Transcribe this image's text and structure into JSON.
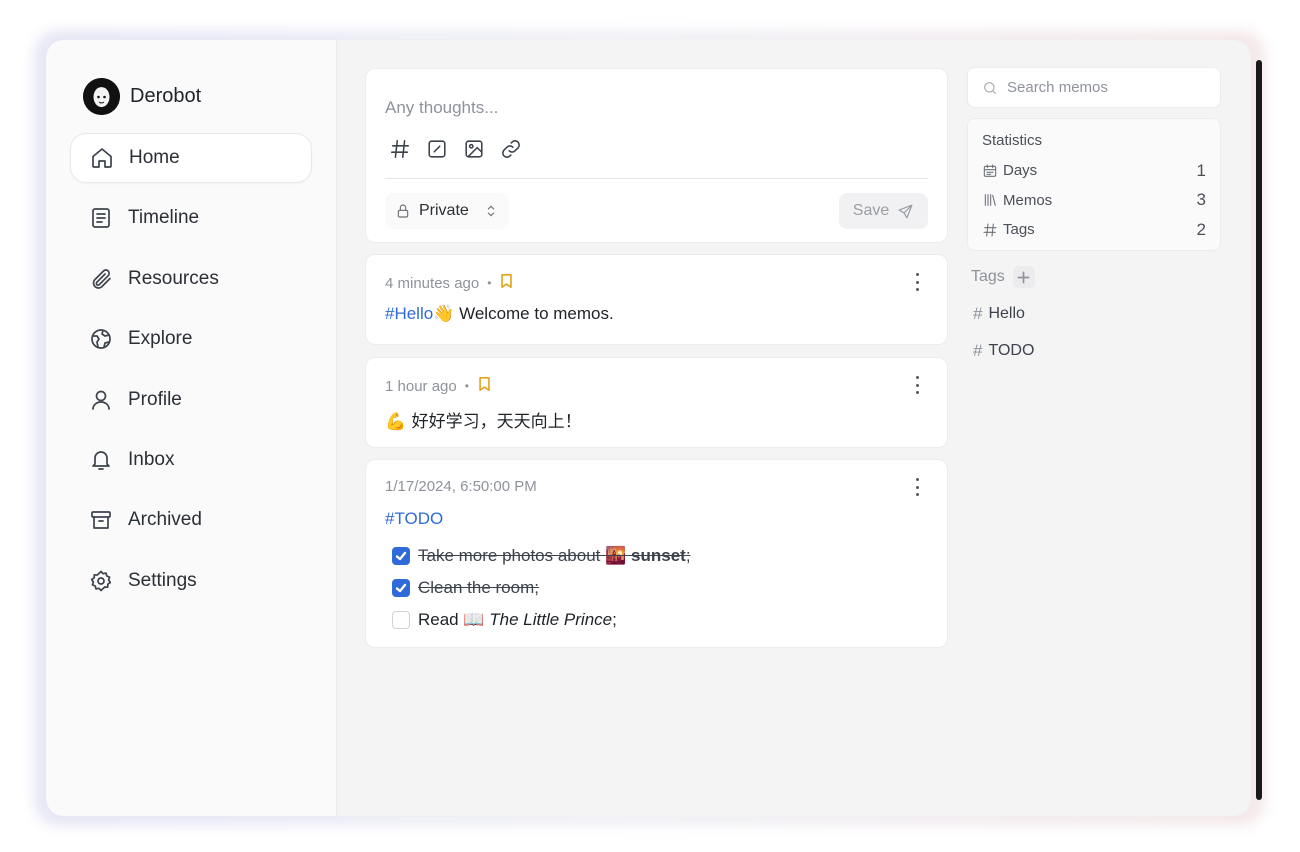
{
  "user": {
    "name": "Derobot"
  },
  "sidebar": {
    "items": [
      {
        "label": "Home",
        "icon": "home-icon",
        "active": true
      },
      {
        "label": "Timeline",
        "icon": "timeline-icon"
      },
      {
        "label": "Resources",
        "icon": "paperclip-icon"
      },
      {
        "label": "Explore",
        "icon": "globe-icon"
      },
      {
        "label": "Profile",
        "icon": "user-icon"
      },
      {
        "label": "Inbox",
        "icon": "bell-icon"
      },
      {
        "label": "Archived",
        "icon": "archive-icon"
      },
      {
        "label": "Settings",
        "icon": "gear-icon"
      }
    ]
  },
  "editor": {
    "placeholder": "Any thoughts...",
    "tools": [
      "hash-icon",
      "checkbox-icon",
      "image-icon",
      "link-icon"
    ],
    "visibility": "Private",
    "save_label": "Save"
  },
  "memos": [
    {
      "time": "4 minutes ago",
      "bookmarked": true,
      "tag": "#Hello",
      "emoji": "👋",
      "text": " Welcome to memos."
    },
    {
      "time": "1 hour ago",
      "bookmarked": true,
      "emoji": "💪",
      "text": " 好好学习，天天向上！"
    },
    {
      "time": "1/17/2024, 6:50:00 PM",
      "tag": "#TODO",
      "todos": [
        {
          "checked": true,
          "text_before": "Take more photos about ",
          "emoji": "🌇",
          "bold": " sunset",
          "text_after": ";"
        },
        {
          "checked": true,
          "text": "Clean the room;"
        },
        {
          "checked": false,
          "text_before": "Read ",
          "emoji": "📖",
          "italic": " The Little Prince",
          "text_after": ";"
        }
      ]
    }
  ],
  "search": {
    "placeholder": "Search memos"
  },
  "statistics": {
    "title": "Statistics",
    "rows": [
      {
        "label": "Days",
        "value": "1",
        "icon": "calendar-icon"
      },
      {
        "label": "Memos",
        "value": "3",
        "icon": "library-icon"
      },
      {
        "label": "Tags",
        "value": "2",
        "icon": "hash-icon"
      }
    ]
  },
  "tags": {
    "title": "Tags",
    "items": [
      "Hello",
      "TODO"
    ]
  },
  "colors": {
    "accent": "#2f6bd8",
    "bookmark": "#e0a21a"
  }
}
